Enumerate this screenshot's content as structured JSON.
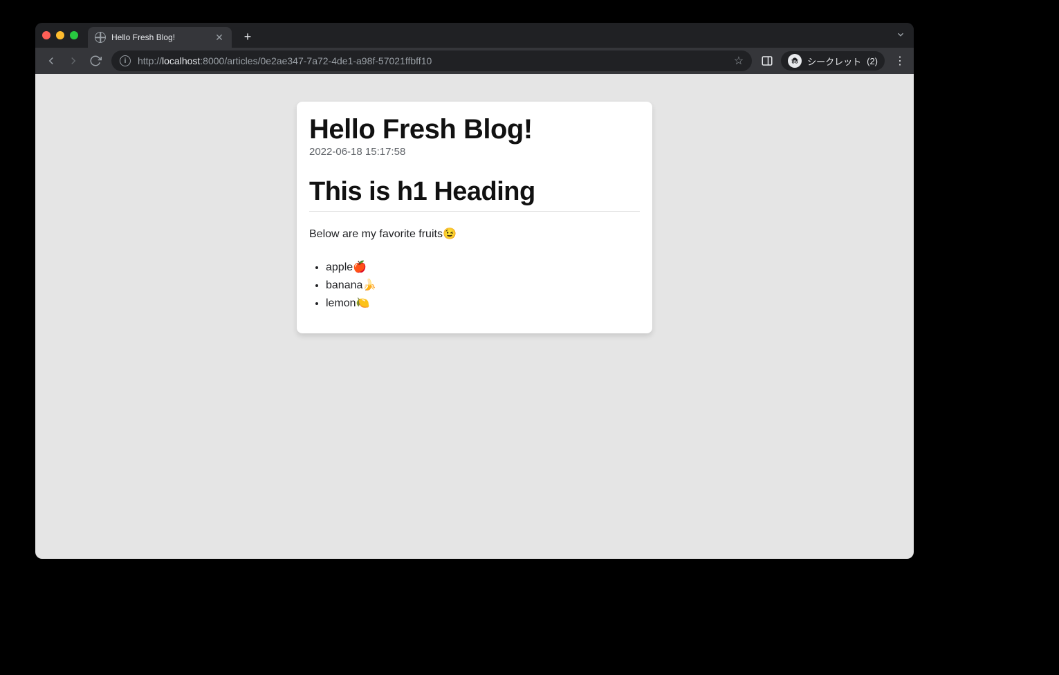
{
  "browser": {
    "tab": {
      "title": "Hello Fresh Blog!"
    },
    "url": {
      "protocol": "http://",
      "host": "localhost",
      "port_path": ":8000/articles/0e2ae347-7a72-4de1-a98f-57021ffbff10"
    },
    "incognito": {
      "label": "シークレット",
      "count": "(2)"
    }
  },
  "article": {
    "site_title": "Hello Fresh Blog!",
    "timestamp": "2022-06-18 15:17:58",
    "heading": "This is h1 Heading",
    "intro": "Below are my favorite fruits😉",
    "fruits": [
      "apple🍎",
      "banana🍌",
      "lemon🍋"
    ]
  }
}
